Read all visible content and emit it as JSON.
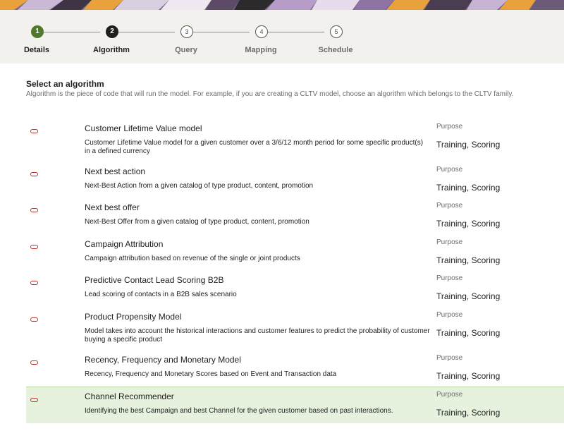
{
  "train": {
    "steps": [
      {
        "number": "1",
        "label": "Details",
        "state": "done"
      },
      {
        "number": "2",
        "label": "Algorithm",
        "state": "current"
      },
      {
        "number": "3",
        "label": "Query",
        "state": "todo"
      },
      {
        "number": "4",
        "label": "Mapping",
        "state": "todo"
      },
      {
        "number": "5",
        "label": "Schedule",
        "state": "todo"
      }
    ]
  },
  "section": {
    "title": "Select an algorithm",
    "description": "Algorithm is the piece of code that will run the model. For example, if you are creating a CLTV model, choose an algorithm which belongs to the CLTV family."
  },
  "algorithms": [
    {
      "name": "Customer Lifetime Value model",
      "description": "Customer Lifetime Value model for a given customer over a 3/6/12 month period for some specific product(s) in a defined currency",
      "purpose_label": "Purpose",
      "purpose": "Training, Scoring",
      "selected": false
    },
    {
      "name": "Next best action",
      "description": "Next-Best Action from a given catalog of type product, content, promotion",
      "purpose_label": "Purpose",
      "purpose": "Training, Scoring",
      "selected": false
    },
    {
      "name": "Next best offer",
      "description": "Next-Best Offer from a given catalog of type product, content, promotion",
      "purpose_label": "Purpose",
      "purpose": "Training, Scoring",
      "selected": false
    },
    {
      "name": "Campaign Attribution",
      "description": "Campaign attribution based on revenue of the single or joint products",
      "purpose_label": "Purpose",
      "purpose": "Training, Scoring",
      "selected": false
    },
    {
      "name": "Predictive Contact Lead Scoring B2B",
      "description": "Lead scoring of contacts in a B2B sales scenario",
      "purpose_label": "Purpose",
      "purpose": "Training, Scoring",
      "selected": false
    },
    {
      "name": "Product Propensity Model",
      "description": "Model takes into account the historical interactions and customer features to predict the probability of customer buying a specific product",
      "purpose_label": "Purpose",
      "purpose": "Training, Scoring",
      "selected": false
    },
    {
      "name": "Recency, Frequency and Monetary Model",
      "description": "Recency, Frequency and Monetary Scores based on Event and Transaction data",
      "purpose_label": "Purpose",
      "purpose": "Training, Scoring",
      "selected": false
    },
    {
      "name": "Channel Recommender",
      "description": "Identifying the best Campaign and best Channel for the given customer based on past interactions.",
      "purpose_label": "Purpose",
      "purpose": "Training, Scoring",
      "selected": true
    }
  ],
  "colors": {
    "step_done": "#4f7a2c",
    "step_current": "#1f1f1f",
    "radio_border": "#c0302a",
    "selected_row_bg": "#e6f2dd"
  }
}
